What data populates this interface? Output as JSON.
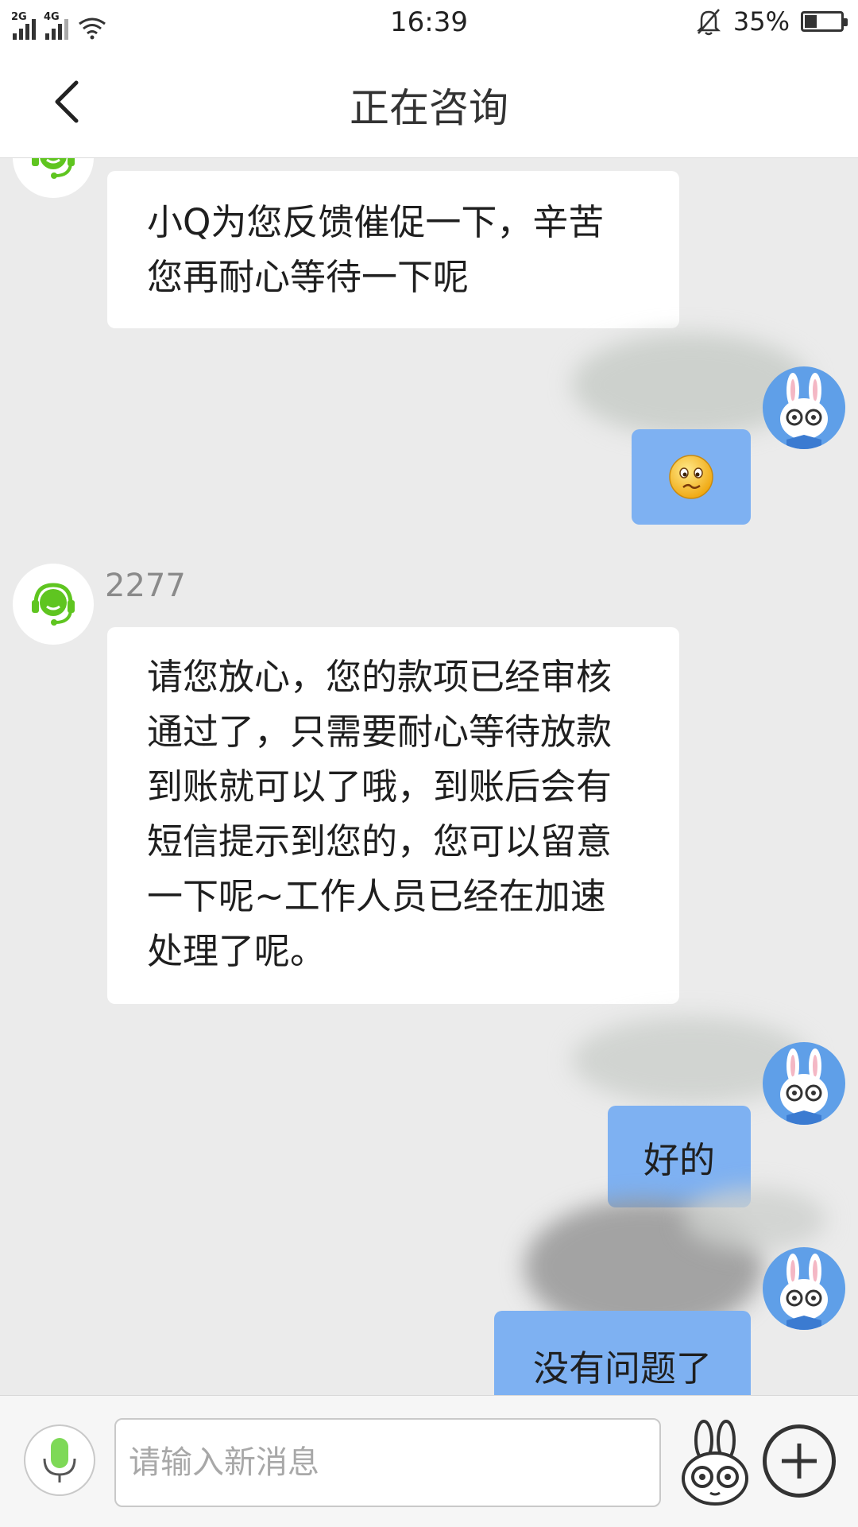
{
  "status_bar": {
    "network_1": "2G",
    "network_2": "4G",
    "time": "16:39",
    "battery": "35%",
    "battery_level": 0.35
  },
  "header": {
    "title": "正在咨询"
  },
  "messages": [
    {
      "from": "agent",
      "text_lines": [
        "小Q为您反馈催促一下，辛苦",
        "您再耐心等待一下呢"
      ]
    },
    {
      "from": "user",
      "emoji": "worried-face-emoji"
    },
    {
      "from": "agent",
      "sender": "2277",
      "text_lines": [
        "请您放心，您的款项已经审核",
        "通过了，只需要耐心等待放款",
        "到账就可以了哦，到账后会有",
        "短信提示到您的，您可以留意",
        "一下呢~工作人员已经在加速",
        "处理了呢。"
      ]
    },
    {
      "from": "user",
      "text": "好的"
    },
    {
      "from": "user",
      "text": "没有问题了"
    }
  ],
  "input_bar": {
    "placeholder": "请输入新消息",
    "voice_icon": "microphone-icon",
    "sticker_icon": "rabbit-sticker-icon",
    "more_icon": "plus-icon"
  },
  "colors": {
    "user_bubble": "#7eb1f2",
    "agent_bubble": "#ffffff",
    "chat_background": "#ebebeb",
    "agent_avatar_green": "#5fc520",
    "user_avatar_blue": "#5f9fe8"
  }
}
